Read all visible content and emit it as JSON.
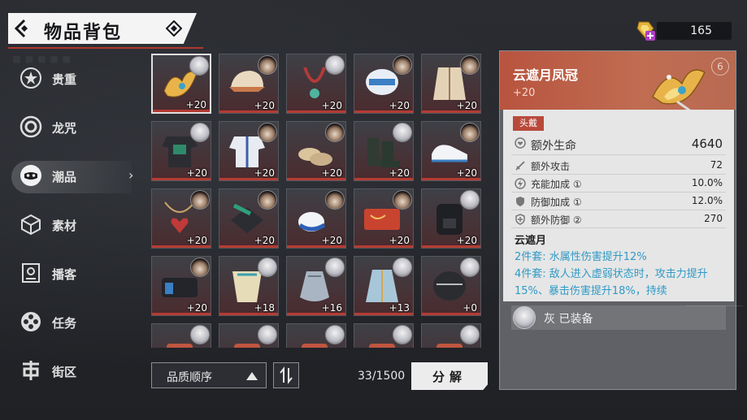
{
  "header": {
    "title": "物品背包",
    "back_icon": "back-icon",
    "info_icon": "diamond-info-icon"
  },
  "currency": {
    "icon": "purple-gem-plus-icon",
    "amount": "165"
  },
  "sidebar": {
    "items": [
      {
        "label": "贵重",
        "icon": "star-badge-icon"
      },
      {
        "label": "龙咒",
        "icon": "ring-icon"
      },
      {
        "label": "潮品",
        "icon": "mask-icon",
        "active": true
      },
      {
        "label": "素材",
        "icon": "cube-icon"
      },
      {
        "label": "播客",
        "icon": "podcast-icon"
      },
      {
        "label": "任务",
        "icon": "film-reel-icon"
      },
      {
        "label": "街区",
        "icon": "district-icon"
      }
    ]
  },
  "grid": {
    "items": [
      {
        "name": "golden-crown",
        "count": "+20",
        "avatar": "white",
        "selected": true
      },
      {
        "name": "cap",
        "count": "+20",
        "avatar": "dark"
      },
      {
        "name": "red-necklace",
        "count": "+20",
        "avatar": "white"
      },
      {
        "name": "white-helmet",
        "count": "+20",
        "avatar": "dark"
      },
      {
        "name": "coat",
        "count": "+20",
        "avatar": "dark"
      },
      {
        "name": "dark-shirt",
        "count": "+20",
        "avatar": "white"
      },
      {
        "name": "white-jacket",
        "count": "+20",
        "avatar": "dark"
      },
      {
        "name": "loafers",
        "count": "+20",
        "avatar": "dark"
      },
      {
        "name": "green-boots",
        "count": "+20",
        "avatar": "white"
      },
      {
        "name": "white-sneakers",
        "count": "+20",
        "avatar": "dark"
      },
      {
        "name": "heart-pendant",
        "count": "+20",
        "avatar": "dark"
      },
      {
        "name": "green-scarf-hat",
        "count": "+20",
        "avatar": "dark"
      },
      {
        "name": "blue-white-shoes",
        "count": "+20",
        "avatar": "dark"
      },
      {
        "name": "red-wallet",
        "count": "+20",
        "avatar": "dark"
      },
      {
        "name": "black-backpack",
        "count": "+20",
        "avatar": "white"
      },
      {
        "name": "blue-bag",
        "count": "+20",
        "avatar": "dark"
      },
      {
        "name": "cape",
        "count": "+18",
        "avatar": "white"
      },
      {
        "name": "grey-sack",
        "count": "+16",
        "avatar": "white"
      },
      {
        "name": "blue-robe",
        "count": "+13",
        "avatar": "white"
      },
      {
        "name": "black-mask",
        "count": "+0",
        "avatar": "white"
      },
      {
        "name": "red-item",
        "count": "",
        "avatar": "white"
      },
      {
        "name": "orange-item",
        "count": "",
        "avatar": "white"
      },
      {
        "name": "scarf-item",
        "count": "",
        "avatar": "white"
      },
      {
        "name": "orange-case",
        "count": "",
        "avatar": "white"
      },
      {
        "name": "dark-purse",
        "count": "",
        "avatar": "white"
      }
    ]
  },
  "controls": {
    "sort_label": "品质顺序",
    "order_icon": "sort-toggle-icon",
    "capacity": "33/1500",
    "decompose_label": "分解"
  },
  "detail": {
    "name": "云遮月凤冠",
    "count": "+20",
    "rank": "6",
    "slot": "头戴",
    "main_stat": {
      "name": "额外生命",
      "value": "4640",
      "icon": "heart-shield-icon"
    },
    "sub_stats": [
      {
        "name": "额外攻击",
        "value": "72",
        "icon": "sword-icon"
      },
      {
        "name": "充能加成 ①",
        "value": "10.0%",
        "icon": "energy-icon"
      },
      {
        "name": "防御加成 ①",
        "value": "12.0%",
        "icon": "shield-icon"
      },
      {
        "name": "额外防御 ②",
        "value": "270",
        "icon": "shield-plus-icon"
      }
    ],
    "set_name": "云遮月",
    "set_2": "2件套: 水属性伤害提升12%",
    "set_4": "4件套: 敌人进入虚弱状态时，攻击力提升15%、暴击伤害提升18%，持续",
    "equipped_text": "灰 已装备"
  },
  "colors": {
    "accent_red": "#b84a3b",
    "panel_header": "#c06d52",
    "set_text": "#2f9ac6"
  }
}
